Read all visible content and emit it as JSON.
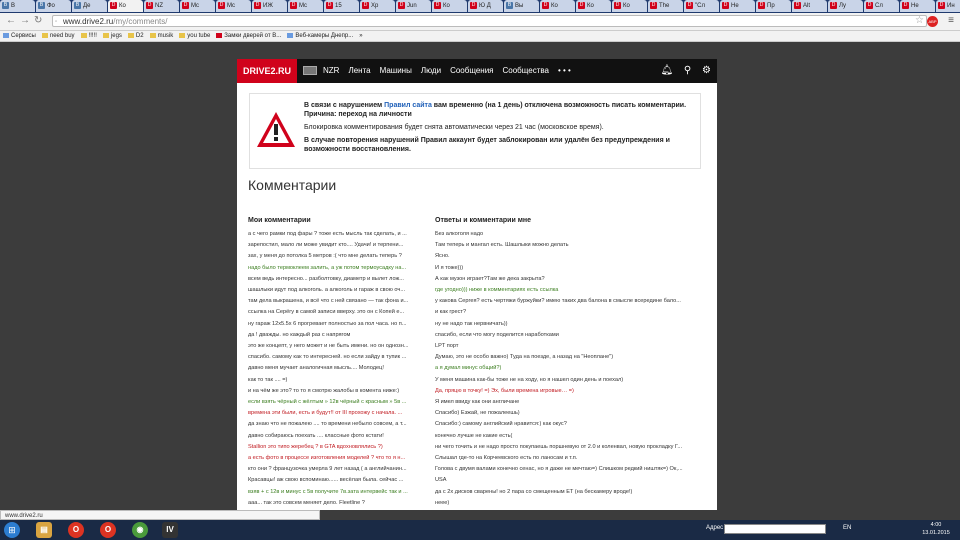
{
  "browser": {
    "tabs": [
      {
        "icon": "vk",
        "label": "В"
      },
      {
        "icon": "vk",
        "label": "Фо"
      },
      {
        "icon": "vk",
        "label": "Де"
      },
      {
        "icon": "d",
        "label": "Ко",
        "active": true
      },
      {
        "icon": "d",
        "label": "NZ"
      },
      {
        "icon": "d",
        "label": "Mc"
      },
      {
        "icon": "d",
        "label": "Mc"
      },
      {
        "icon": "d",
        "label": "ИЖ"
      },
      {
        "icon": "d",
        "label": "Mc"
      },
      {
        "icon": "d",
        "label": "15"
      },
      {
        "icon": "d",
        "label": "Хр"
      },
      {
        "icon": "d",
        "label": "Jun"
      },
      {
        "icon": "d",
        "label": "Ко"
      },
      {
        "icon": "d",
        "label": "Ю Д"
      },
      {
        "icon": "vk",
        "label": "Вы"
      },
      {
        "icon": "d",
        "label": "Ко"
      },
      {
        "icon": "d",
        "label": "Ко"
      },
      {
        "icon": "d",
        "label": "Ко"
      },
      {
        "icon": "d",
        "label": "The"
      },
      {
        "icon": "d",
        "label": "\"Сл"
      },
      {
        "icon": "d",
        "label": "Не"
      },
      {
        "icon": "d",
        "label": "Пр"
      },
      {
        "icon": "d",
        "label": "Alt"
      },
      {
        "icon": "d",
        "label": "Лу"
      },
      {
        "icon": "d",
        "label": "Сл"
      },
      {
        "icon": "d",
        "label": "Не"
      },
      {
        "icon": "d",
        "label": "Ин"
      }
    ],
    "url_host": "www.drive2.ru",
    "url_path": "/my/comments/",
    "bookmarks": [
      {
        "label": "Сервисы",
        "type": "app"
      },
      {
        "label": "need buy",
        "type": "folder"
      },
      {
        "label": "!!!!!",
        "type": "folder"
      },
      {
        "label": "jegs",
        "type": "folder"
      },
      {
        "label": "D2",
        "type": "folder"
      },
      {
        "label": "musik",
        "type": "folder"
      },
      {
        "label": "you tube",
        "type": "folder"
      },
      {
        "label": "Замки дверей от В...",
        "type": "d"
      },
      {
        "label": "Веб-камеры Днепр...",
        "type": "app"
      },
      {
        "label": "»",
        "type": "none"
      }
    ]
  },
  "site": {
    "logo": "DRIVE2.RU",
    "nav": [
      "NZR",
      "Лента",
      "Машины",
      "Люди",
      "Сообщения",
      "Сообщества",
      "• • •"
    ],
    "warning": {
      "line1_pre": "В связи с нарушением ",
      "line1_link": "Правил сайта",
      "line1_post": " вам временно (на 1 день) отключена возможность писать комментарии. Причина: переход на личности",
      "line2": "Блокировка комментирования будет снята автоматически через 21 час (московское время).",
      "line3": "В случае повторения нарушений Правил аккаунт будет заблокирован или удалён без предупреждения и возможности восстановления."
    },
    "title": "Комментарии",
    "my_comments_title": "Мои комментарии",
    "replies_title": "Ответы и комментарии мне",
    "my_comments": [
      {
        "t": "а с чего рамки под фары ? тоже есть мысль так сделать, и ...",
        "c": ""
      },
      {
        "t": "зарепостил, мало ли може увидит кто.... Удачи! и терпени...",
        "c": ""
      },
      {
        "t": "зах, у меня до потолка 5 метров :( что мне делать теперь ?",
        "c": ""
      },
      {
        "t": "надо было термоклеем залить, а уж потом термоусадку на...",
        "c": "green"
      },
      {
        "t": "всем ведь интересно... разболтовку, диаметр и вылет лож...",
        "c": ""
      },
      {
        "t": "шашлыки идут под алкоголь. а алкоголь и гараж в свою оч...",
        "c": ""
      },
      {
        "t": "там дела выкрашена, и всё что с ней связано — так фона и...",
        "c": ""
      },
      {
        "t": "ссылка на Серёгу в самой записи вверху. это он с Копей е...",
        "c": ""
      },
      {
        "t": "ну гараж 12х5.5х 6 прогревает полностью за пол часа. но п...",
        "c": ""
      },
      {
        "t": "да ! дважды. но каждый раз с напрягом",
        "c": ""
      },
      {
        "t": "это же концепт, у него может и не быть имени. но он однозн...",
        "c": ""
      },
      {
        "t": "спасибо. самому как то интересней. но если зайду в тупик ...",
        "c": ""
      },
      {
        "t": "давно меня мучает аналогичная мысль.... Молодец!",
        "c": ""
      },
      {
        "t": "как то так .... =)",
        "c": ""
      },
      {
        "t": "и на чём же это? то то я смотрю жалобы в комента ниже:)",
        "c": ""
      },
      {
        "t": "если взять чёрный с жёлтым » 12в чёрный с красным » 5в ...",
        "c": "green"
      },
      {
        "t": "времена эти были, есть и будут!! от III прохожу с начала. ...",
        "c": "red"
      },
      {
        "t": "да знаю что не пожалею .... то времени небыло совсем, а т...",
        "c": ""
      },
      {
        "t": "давно собираюсь поехать .... классные фото кстати!",
        "c": ""
      },
      {
        "t": "Stallion это типо жеребец ? в GTA вдохновлялись ?)",
        "c": "red"
      },
      {
        "t": "а есть фото в процессе изготовления моделей ? что то я н...",
        "c": "red"
      },
      {
        "t": "кто они ? французочка умерла 9 лет назад ( а английчанин...",
        "c": ""
      },
      {
        "t": "Красавцы! аж свою вспоминаю...... весёлая была. сейчас ...",
        "c": ""
      },
      {
        "t": "взяв + с 12в и минус с 5в получите 7в.зата интервейс так и ...",
        "c": "green"
      },
      {
        "t": "ааа... так это совсем меняет дело. Fleetline ?",
        "c": ""
      },
      {
        "t": "с лентой лучше.",
        "c": ""
      },
      {
        "t": "ну не 3ис точно! а хоть какой страны этот представитель а...",
        "c": ""
      },
      {
        "t": "......... смежешь достать голову с двух...",
        "c": ""
      }
    ],
    "replies": [
      {
        "t": "Без алкоголя надо",
        "c": ""
      },
      {
        "t": "Там теперь и мангал есть. Шашлыки можно делать",
        "c": ""
      },
      {
        "t": "Ясно.",
        "c": ""
      },
      {
        "t": "И я тоже)))",
        "c": ""
      },
      {
        "t": "А как музон играет?Там же дека закрыта?",
        "c": ""
      },
      {
        "t": "где угодно))) ниже в комментариях есть ссылка",
        "c": "green"
      },
      {
        "t": "у какова Сергея? есть чертяжи буржуйки? имею таких два балона в смысле всередине бало...",
        "c": ""
      },
      {
        "t": "и как грест?",
        "c": ""
      },
      {
        "t": "ну не надо так нервничать))",
        "c": ""
      },
      {
        "t": "спасибо, если что могу поделится наработками",
        "c": ""
      },
      {
        "t": "LPT порт",
        "c": ""
      },
      {
        "t": "Думаю, это не особо важно) Туда на поезде, а назад на \"Неоплане\")",
        "c": ""
      },
      {
        "t": "а я думал минус общий?)",
        "c": "green"
      },
      {
        "t": "У меня машина как-бы тоже не на ходу, но я нашел один день и поехал)",
        "c": ""
      },
      {
        "t": "Да, пряцю в точку! =) Эх, были времена игровые… =)",
        "c": "red"
      },
      {
        "t": "Я имел ввиду как они англичане",
        "c": ""
      },
      {
        "t": "Спасибо) Езжай, не пожалеешь)",
        "c": ""
      },
      {
        "t": "Спасибо:) самому английский нравится:) как окус?",
        "c": ""
      },
      {
        "t": "конечно лучше не какие есть(",
        "c": ""
      },
      {
        "t": "ни чего точить и не надо просто покупаешь поршневую от 2.0 и коленвал, новую прокладку Г...",
        "c": ""
      },
      {
        "t": "Слышал где-то на Корчеевского есть по ланосам и т.п.",
        "c": ""
      },
      {
        "t": "Голова с двумя валами конечно сенас, но я даже не мечтаю=) Слишком редкий ништяк=) Ок,...",
        "c": ""
      },
      {
        "t": "USA",
        "c": ""
      },
      {
        "t": "да с 2х дисков сварены! но 2 пара со смещенным ET (на бескамеру вроде!)",
        "c": ""
      },
      {
        "t": "неее)",
        "c": ""
      },
      {
        "t": "Ну, так то да… Надо будет как то подъехать, спросить...",
        "c": ""
      },
      {
        "t": "Нет, сколирован с контакта",
        "c": ""
      },
      {
        "t": "Если честно сам в конце не догнал что за \"высокое сердцо\" но почему-то представил себе к...",
        "c": ""
      }
    ]
  },
  "status_text": "www.drive2.ru",
  "taskbar": {
    "addr_label": "Адрес",
    "lang": "EN",
    "time": "4:00",
    "date": "13.01.2015"
  }
}
